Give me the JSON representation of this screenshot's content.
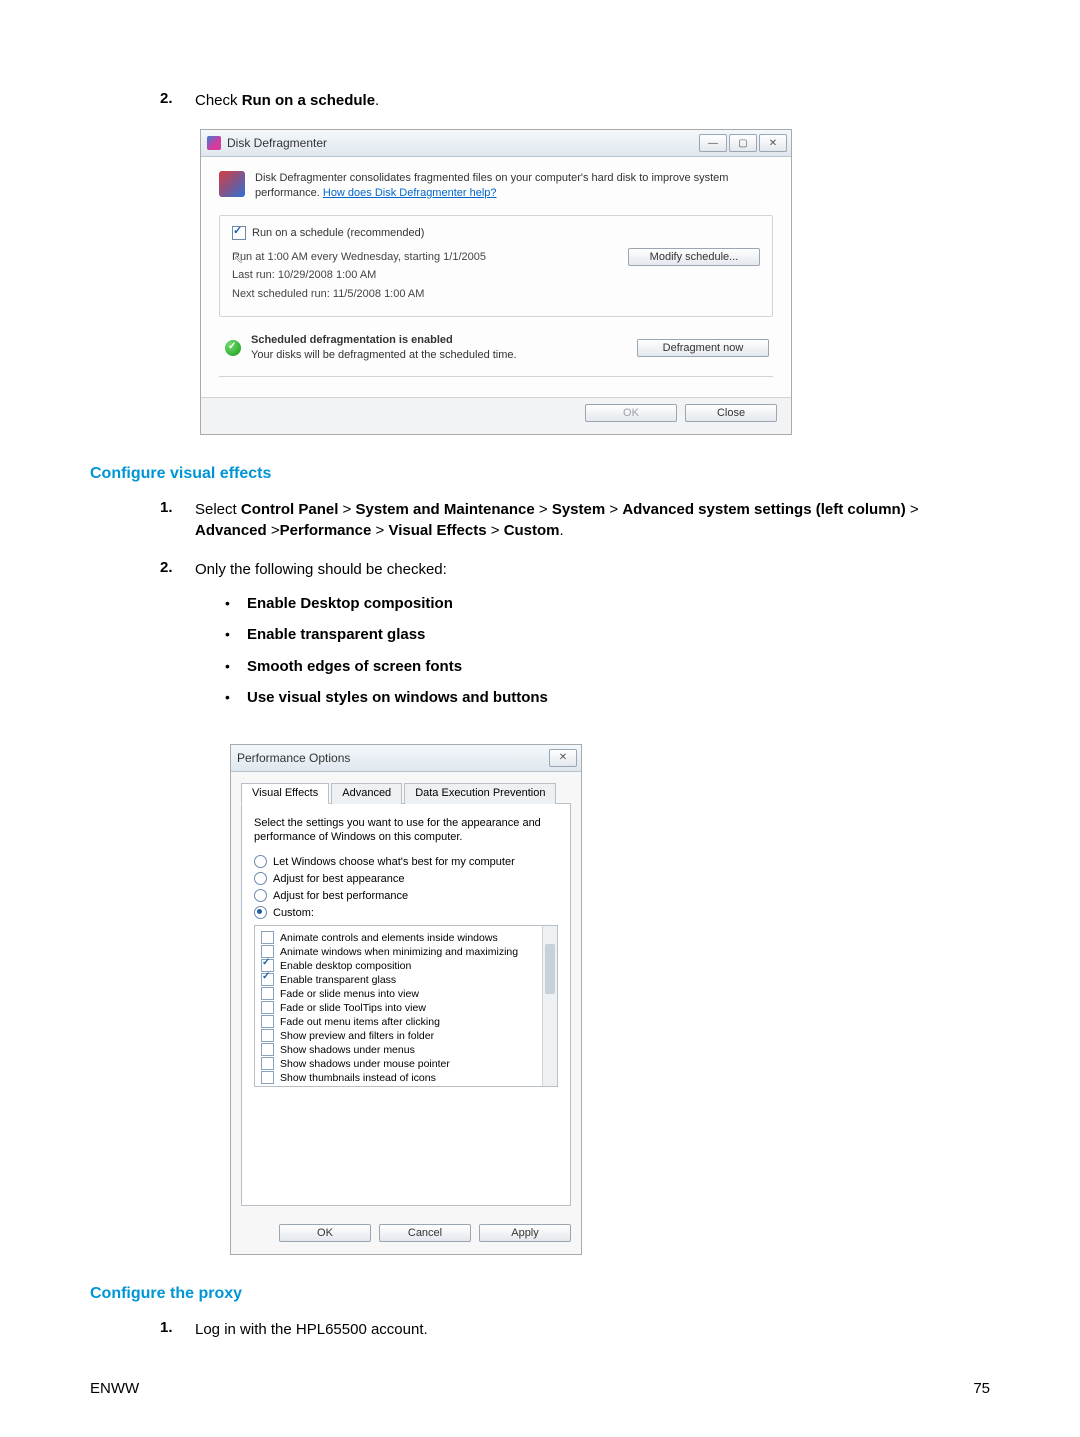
{
  "step2": {
    "num": "2.",
    "prefix": "Check ",
    "bold": "Run on a schedule",
    "suffix": "."
  },
  "defrag": {
    "title": "Disk Defragmenter",
    "min_glyph": "—",
    "max_glyph": "▢",
    "close_glyph": "✕",
    "intro_text": "Disk Defragmenter consolidates fragmented files on your computer's hard disk to improve system performance. ",
    "intro_link": "How does Disk Defragmenter help?",
    "chk_label": "Run on a schedule (recommended)",
    "line1": "Run at 1:00 AM every Wednesday, starting 1/1/2005",
    "line2": "Last run: 10/29/2008 1:00 AM",
    "line3": "Next scheduled run: 11/5/2008 1:00 AM",
    "modify_btn": "Modify schedule...",
    "status_bold": "Scheduled defragmentation is enabled",
    "status_sub": "Your disks will be defragmented at the scheduled time.",
    "defrag_now_btn": "Defragment now",
    "ok_btn": "OK",
    "close_btn": "Close"
  },
  "section_visual": "Configure visual effects",
  "vstep1": {
    "num": "1.",
    "p1": "Select ",
    "b1": "Control Panel",
    "gt": " > ",
    "b2": "System and Maintenance",
    "b3": "System",
    "b4": "Advanced system settings (left column)",
    "b5": "Advanced",
    "gt2": " >",
    "b6": "Performance",
    "b7": "Visual Effects",
    "b8": "Custom",
    "dot": "."
  },
  "vstep2": {
    "num": "2.",
    "text": "Only the following should be checked:",
    "bullets": [
      "Enable Desktop composition",
      "Enable transparent glass",
      "Smooth edges of screen fonts",
      "Use visual styles on windows and buttons"
    ]
  },
  "perf": {
    "title": "Performance Options",
    "close_glyph": "✕",
    "tabs": [
      "Visual Effects",
      "Advanced",
      "Data Execution Prevention"
    ],
    "desc": "Select the settings you want to use for the appearance and performance of Windows on this computer.",
    "radios": [
      "Let Windows choose what's best for my computer",
      "Adjust for best appearance",
      "Adjust for best performance",
      "Custom:"
    ],
    "list": [
      {
        "c": false,
        "t": "Animate controls and elements inside windows"
      },
      {
        "c": false,
        "t": "Animate windows when minimizing and maximizing"
      },
      {
        "c": true,
        "t": "Enable desktop composition"
      },
      {
        "c": true,
        "t": "Enable transparent glass"
      },
      {
        "c": false,
        "t": "Fade or slide menus into view"
      },
      {
        "c": false,
        "t": "Fade or slide ToolTips into view"
      },
      {
        "c": false,
        "t": "Fade out menu items after clicking"
      },
      {
        "c": false,
        "t": "Show preview and filters in folder"
      },
      {
        "c": false,
        "t": "Show shadows under menus"
      },
      {
        "c": false,
        "t": "Show shadows under mouse pointer"
      },
      {
        "c": false,
        "t": "Show thumbnails instead of icons"
      }
    ],
    "ok": "OK",
    "cancel": "Cancel",
    "apply": "Apply"
  },
  "section_proxy": "Configure the proxy",
  "pstep1": {
    "num": "1.",
    "text": "Log in with the HPL65500 account."
  },
  "footer_left": "ENWW",
  "footer_right": "75"
}
